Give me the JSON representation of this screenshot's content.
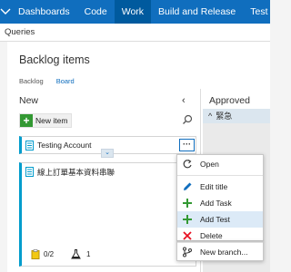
{
  "topnav": {
    "items": [
      "Dashboards",
      "Code",
      "Work",
      "Build and Release",
      "Test"
    ],
    "active": "Work"
  },
  "querybar": {
    "label": "Queries"
  },
  "page": {
    "title": "Backlog items",
    "tabs": [
      "Backlog",
      "Board"
    ],
    "active_tab": "Board"
  },
  "columns": {
    "new": {
      "label": "New"
    },
    "approved": {
      "label": "Approved"
    },
    "swimlane": {
      "label": "緊急"
    }
  },
  "new_item_button": {
    "label": "New item"
  },
  "cards": [
    {
      "title": "Testing Account"
    },
    {
      "title": "線上訂單基本資料串聯",
      "tasks": "0/2",
      "tests": "1"
    }
  ],
  "context_menu": {
    "items": [
      {
        "label": "Open",
        "icon": "open-icon"
      },
      {
        "label": "Edit title",
        "icon": "pencil-icon"
      },
      {
        "label": "Add Task",
        "icon": "plus-icon"
      },
      {
        "label": "Add Test",
        "icon": "plus-icon"
      },
      {
        "label": "Delete",
        "icon": "x-icon"
      },
      {
        "label": "New branch...",
        "icon": "branch-icon"
      }
    ],
    "hovered": "Add Test"
  },
  "colors": {
    "nav": "#106ebe",
    "nav_active": "#005a9e",
    "card_accent": "#009ccc",
    "add_green": "#339933",
    "delete_red": "#e81123"
  }
}
